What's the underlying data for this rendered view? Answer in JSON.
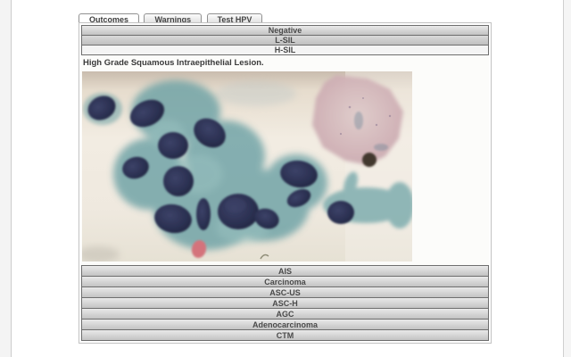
{
  "tabs": [
    {
      "label": "Outcomes",
      "active": true
    },
    {
      "label": "Warnings",
      "active": false
    },
    {
      "label": "Test HPV",
      "active": false
    }
  ],
  "accordion": {
    "items": [
      {
        "label": "Negative"
      },
      {
        "label": "L-SIL"
      },
      {
        "label": "H-SIL",
        "expanded": true
      },
      {
        "label": "AIS"
      },
      {
        "label": "Carcinoma"
      },
      {
        "label": "ASC-US"
      },
      {
        "label": "ASC-H"
      },
      {
        "label": "AGC"
      },
      {
        "label": "Adenocarcinoma"
      },
      {
        "label": "CTM"
      }
    ],
    "expanded_content": {
      "item": "H-SIL",
      "description": "High Grade Squamous Intraepithelial Lesion.",
      "image": "pap-smear-micrograph-hsil"
    }
  },
  "colors": {
    "tab_text": "#454545",
    "row_gradient_top": "#e9e9e9",
    "row_gradient_bottom": "#c3c3c3",
    "row_border": "#6e6e6e",
    "active_row_bg": "#f4f4f4",
    "panel_border": "#c2c2c2",
    "micrograph_background": "#efe9df",
    "micrograph_cytoplasm_teal": "#6ba0a4",
    "micrograph_nucleus_navy": "#272c4b",
    "micrograph_squamous_pink": "#ccadb3",
    "micrograph_red_blob": "#d4737c"
  }
}
